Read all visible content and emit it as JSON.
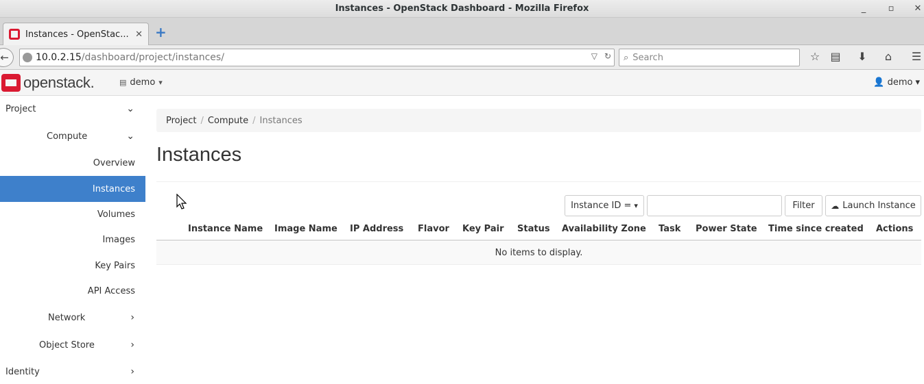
{
  "window": {
    "title": "Instances - OpenStack Dashboard - Mozilla Firefox"
  },
  "browser": {
    "tab_label": "Instances - OpenStac...",
    "url_host": "10.0.2.15",
    "url_path": "/dashboard/project/instances/",
    "search_placeholder": "Search"
  },
  "header": {
    "logo_text": "openstack.",
    "project": "demo",
    "user": "demo"
  },
  "sidebar": {
    "project": "Project",
    "compute": "Compute",
    "items": [
      "Overview",
      "Instances",
      "Volumes",
      "Images",
      "Key Pairs",
      "API Access"
    ],
    "active_index": 1,
    "network": "Network",
    "object_store": "Object Store",
    "identity": "Identity"
  },
  "breadcrumb": {
    "project": "Project",
    "compute": "Compute",
    "current": "Instances"
  },
  "page": {
    "title": "Instances"
  },
  "toolbar": {
    "filter_field": "Instance ID =",
    "filter_button": "Filter",
    "launch_button": "Launch Instance"
  },
  "table": {
    "columns": [
      "Instance Name",
      "Image Name",
      "IP Address",
      "Flavor",
      "Key Pair",
      "Status",
      "Availability Zone",
      "Task",
      "Power State",
      "Time since created",
      "Actions"
    ],
    "empty_message": "No items to display."
  },
  "colors": {
    "accent": "#3e80cb",
    "brand": "#da1a32"
  }
}
